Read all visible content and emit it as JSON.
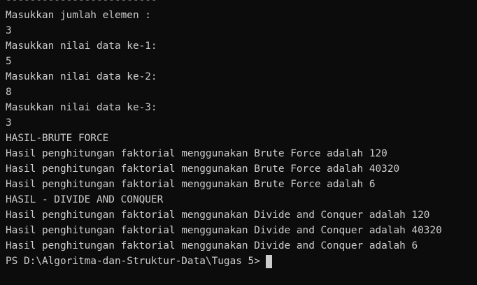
{
  "terminal": {
    "lines": [
      "-------------------------",
      "Masukkan jumlah elemen :",
      "3",
      "Masukkan nilai data ke-1:",
      "5",
      "Masukkan nilai data ke-2:",
      "8",
      "Masukkan nilai data ke-3:",
      "3",
      "HASIL-BRUTE FORCE",
      "Hasil penghitungan faktorial menggunakan Brute Force adalah 120",
      "Hasil penghitungan faktorial menggunakan Brute Force adalah 40320",
      "Hasil penghitungan faktorial menggunakan Brute Force adalah 6",
      "HASIL - DIVIDE AND CONQUER",
      "Hasil penghitungan faktorial menggunakan Divide and Conquer adalah 120",
      "Hasil penghitungan faktorial menggunakan Divide and Conquer adalah 40320",
      "Hasil penghitungan faktorial menggunakan Divide and Conquer adalah 6"
    ],
    "prompt": "PS D:\\Algoritma-dan-Struktur-Data\\Tugas 5>",
    "colors": {
      "background": "#0c0c0c",
      "foreground": "#cccccc"
    }
  }
}
